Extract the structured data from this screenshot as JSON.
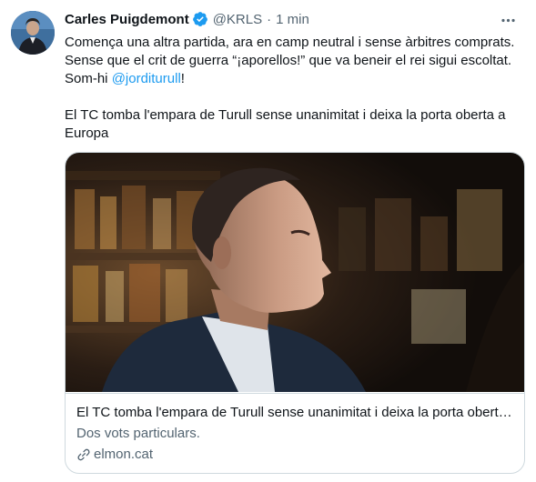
{
  "author": {
    "display_name": "Carles Puigdemont",
    "handle": "@KRLS",
    "separator": "·",
    "time": "1 min"
  },
  "tweet": {
    "line1": "Comença una altra partida, ara en camp neutral i sense àrbitres comprats.",
    "line2": "Sense que el crit de guerra “¡aporellos!” que va beneir el rei sigui escoltat.",
    "line3_prefix": "Som-hi ",
    "mention": "@jorditurull",
    "line3_suffix": "!",
    "line4": "El TC tomba l'empara de Turull sense unanimitat i deixa la porta oberta a",
    "line5": "Europa"
  },
  "card": {
    "title": "El TC tomba l'empara de Turull sense unanimitat i deixa la porta oberta…",
    "description": "Dos vots particulars.",
    "domain": "elmon.cat"
  },
  "colors": {
    "accent": "#1d9bf0",
    "secondary_text": "#536471",
    "border": "#cfd9de"
  },
  "icons": [
    "verified-badge-icon",
    "more-options-icon",
    "link-icon"
  ]
}
